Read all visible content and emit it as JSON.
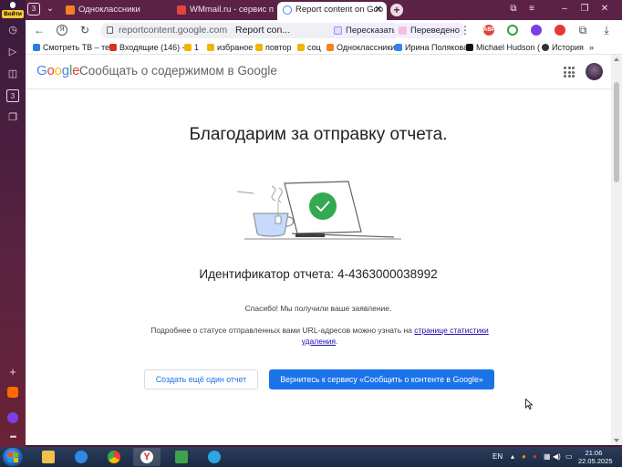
{
  "sidebar": {
    "login_label": "Войти",
    "tab_count": "3"
  },
  "tabs": [
    {
      "label": "Одноклассники",
      "favicon_color": "#f58220"
    },
    {
      "label": "WMmail.ru - сервис почто",
      "favicon_color": "#e2463a"
    },
    {
      "label": "Report content on Goo",
      "favicon_color": "#4285f4",
      "active": true
    }
  ],
  "address_bar": {
    "url": "reportcontent.google.com",
    "page_title": "Report con...",
    "retell_label": "Пересказать",
    "translated_label": "Переведено"
  },
  "bookmarks": [
    {
      "label": "Смотреть ТВ – те",
      "color": "#2a7de1"
    },
    {
      "label": "Входящие (146) -",
      "color": "#d93025"
    },
    {
      "label": "1",
      "color": "#f4b400"
    },
    {
      "label": "избраное",
      "color": "#f4b400"
    },
    {
      "label": "повтор",
      "color": "#f4b400"
    },
    {
      "label": "соц",
      "color": "#f4b400"
    },
    {
      "label": "Одноклассники",
      "color": "#f58220"
    },
    {
      "label": "Ирина Полякова",
      "color": "#2787f5"
    },
    {
      "label": "Michael Hudson (",
      "color": "#111111"
    },
    {
      "label": "История",
      "color": "#333333"
    }
  ],
  "header": {
    "google": "Google",
    "title": "Сообщать о содержимом в Google"
  },
  "main": {
    "thanks": "Благодарим за отправку отчета.",
    "report_id": "Идентификатор отчета: 4-4363000038992",
    "received": "Спасибо! Мы получили ваше заявление.",
    "more_info_text": "Подробнее о статусе отправленных вами URL-адресов можно узнать на ",
    "more_info_link": "странице статистики удаления",
    "more_info_end": ".",
    "create_another": "Создать ещё один отчет",
    "return_button": "Вернитесь к сервису «Сообщить о контенте в Google»"
  },
  "taskbar": {
    "language": "EN",
    "time": "21:06",
    "date": "22.05.2025"
  },
  "colors": {
    "accent_blue": "#1a73e8",
    "success_green": "#34a853",
    "browser_frame": "#5b2246"
  }
}
